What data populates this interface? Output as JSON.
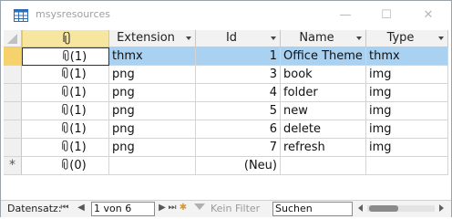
{
  "window": {
    "title": "msysresources",
    "minimize_glyph": "—",
    "maximize_glyph": "☐",
    "close_glyph": "✕"
  },
  "table": {
    "attach_header_icon": "paperclip-icon",
    "columns": [
      {
        "key": "ext",
        "label": "Extension"
      },
      {
        "key": "id",
        "label": "Id"
      },
      {
        "key": "name",
        "label": "Name"
      },
      {
        "key": "type",
        "label": "Type"
      }
    ],
    "rows": [
      {
        "attach": "(1)",
        "ext": "thmx",
        "id": "1",
        "name": "Office Theme",
        "type": "thmx",
        "current": true
      },
      {
        "attach": "(1)",
        "ext": "png",
        "id": "3",
        "name": "book",
        "type": "img"
      },
      {
        "attach": "(1)",
        "ext": "png",
        "id": "4",
        "name": "folder",
        "type": "img"
      },
      {
        "attach": "(1)",
        "ext": "png",
        "id": "5",
        "name": "new",
        "type": "img"
      },
      {
        "attach": "(1)",
        "ext": "png",
        "id": "6",
        "name": "delete",
        "type": "img"
      },
      {
        "attach": "(1)",
        "ext": "png",
        "id": "7",
        "name": "refresh",
        "type": "img"
      }
    ],
    "new_row": {
      "selector": "*",
      "attach": "(0)",
      "id": "(Neu)"
    }
  },
  "navigation": {
    "label": "Datensatz:",
    "position": "1 von 6",
    "filter_label": "Kein Filter",
    "search_placeholder": "Suchen"
  },
  "colors": {
    "current_row": "#a9d1f2",
    "record_selector_current": "#f5d26b",
    "attach_header": "#f6e6a0"
  }
}
